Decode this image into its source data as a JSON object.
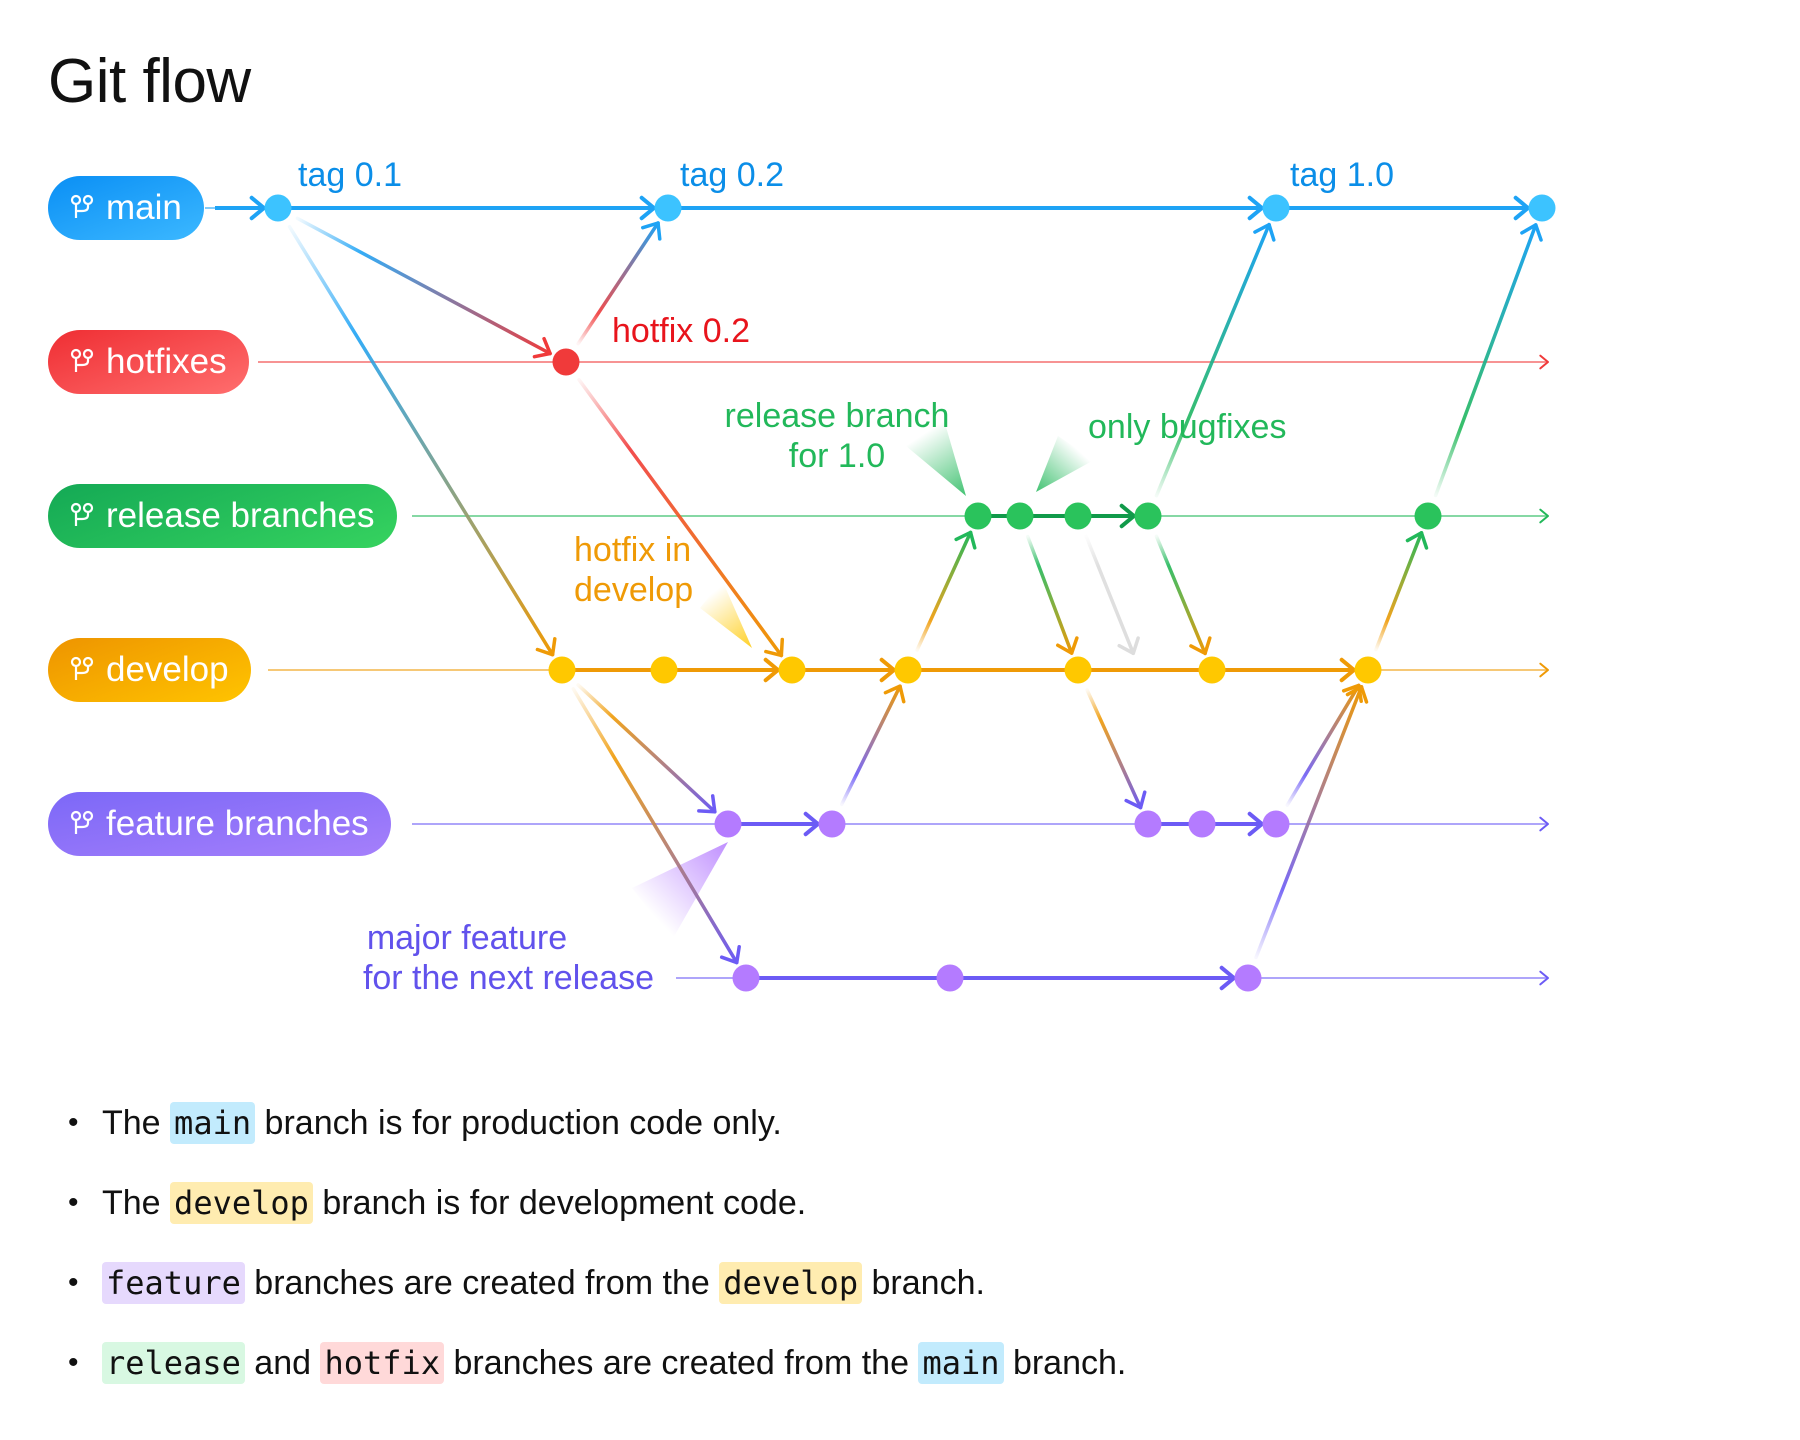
{
  "title": "Git flow",
  "colors": {
    "main": "#1ea3f5",
    "main_dot": "#3cc3ff",
    "hotfix": "#f03a3a",
    "release": "#22b85a",
    "release_dot": "#2ac35c",
    "develop": "#ef9a06",
    "develop_dot": "#ffc800",
    "feature": "#6c5bf5",
    "feature_dot": "#b47bff"
  },
  "branches": [
    {
      "key": "main",
      "label": "main",
      "icon": "git-branch-icon"
    },
    {
      "key": "hotfix",
      "label": "hotfixes",
      "icon": "git-branch-icon"
    },
    {
      "key": "release",
      "label": "release branches",
      "icon": "git-branch-icon"
    },
    {
      "key": "develop",
      "label": "develop",
      "icon": "git-branch-icon"
    },
    {
      "key": "feature",
      "label": "feature branches",
      "icon": "git-branch-icon"
    }
  ],
  "annotations": {
    "tag01": "tag 0.1",
    "tag02": "tag 0.2",
    "tag10": "tag 1.0",
    "hotfix02": "hotfix 0.2",
    "release_for_line1": "release branch",
    "release_for_line2": "for 1.0",
    "only_bugfixes": "only bugfixes",
    "hotfix_in_develop_line1": "hotfix in",
    "hotfix_in_develop_line2": "develop",
    "major_feature_line1": "major feature",
    "major_feature_line2": "for the next release"
  },
  "bullets": [
    {
      "parts": [
        {
          "t": "The "
        },
        {
          "code": "main",
          "cls": "c-main"
        },
        {
          "t": " branch is for production code only."
        }
      ]
    },
    {
      "parts": [
        {
          "t": "The "
        },
        {
          "code": "develop",
          "cls": "c-develop"
        },
        {
          "t": " branch is for development code."
        }
      ]
    },
    {
      "parts": [
        {
          "code": "feature",
          "cls": "c-feature"
        },
        {
          "t": " branches are created from the "
        },
        {
          "code": "develop",
          "cls": "c-develop"
        },
        {
          "t": " branch."
        }
      ]
    },
    {
      "parts": [
        {
          "code": "release",
          "cls": "c-release"
        },
        {
          "t": " and "
        },
        {
          "code": "hotfix",
          "cls": "c-hotfix"
        },
        {
          "t": " branches are created from the "
        },
        {
          "code": "main",
          "cls": "c-main"
        },
        {
          "t": " branch."
        }
      ]
    }
  ]
}
